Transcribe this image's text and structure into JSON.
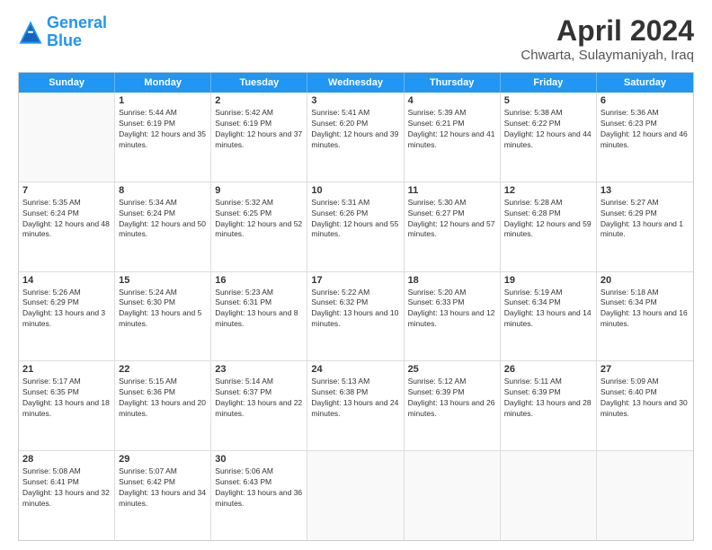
{
  "header": {
    "logo_line1": "General",
    "logo_line2": "Blue",
    "title": "April 2024",
    "subtitle": "Chwarta, Sulaymaniyah, Iraq"
  },
  "weekdays": [
    "Sunday",
    "Monday",
    "Tuesday",
    "Wednesday",
    "Thursday",
    "Friday",
    "Saturday"
  ],
  "weeks": [
    [
      {
        "day": "",
        "sunrise": "",
        "sunset": "",
        "daylight": ""
      },
      {
        "day": "1",
        "sunrise": "Sunrise: 5:44 AM",
        "sunset": "Sunset: 6:19 PM",
        "daylight": "Daylight: 12 hours and 35 minutes."
      },
      {
        "day": "2",
        "sunrise": "Sunrise: 5:42 AM",
        "sunset": "Sunset: 6:19 PM",
        "daylight": "Daylight: 12 hours and 37 minutes."
      },
      {
        "day": "3",
        "sunrise": "Sunrise: 5:41 AM",
        "sunset": "Sunset: 6:20 PM",
        "daylight": "Daylight: 12 hours and 39 minutes."
      },
      {
        "day": "4",
        "sunrise": "Sunrise: 5:39 AM",
        "sunset": "Sunset: 6:21 PM",
        "daylight": "Daylight: 12 hours and 41 minutes."
      },
      {
        "day": "5",
        "sunrise": "Sunrise: 5:38 AM",
        "sunset": "Sunset: 6:22 PM",
        "daylight": "Daylight: 12 hours and 44 minutes."
      },
      {
        "day": "6",
        "sunrise": "Sunrise: 5:36 AM",
        "sunset": "Sunset: 6:23 PM",
        "daylight": "Daylight: 12 hours and 46 minutes."
      }
    ],
    [
      {
        "day": "7",
        "sunrise": "Sunrise: 5:35 AM",
        "sunset": "Sunset: 6:24 PM",
        "daylight": "Daylight: 12 hours and 48 minutes."
      },
      {
        "day": "8",
        "sunrise": "Sunrise: 5:34 AM",
        "sunset": "Sunset: 6:24 PM",
        "daylight": "Daylight: 12 hours and 50 minutes."
      },
      {
        "day": "9",
        "sunrise": "Sunrise: 5:32 AM",
        "sunset": "Sunset: 6:25 PM",
        "daylight": "Daylight: 12 hours and 52 minutes."
      },
      {
        "day": "10",
        "sunrise": "Sunrise: 5:31 AM",
        "sunset": "Sunset: 6:26 PM",
        "daylight": "Daylight: 12 hours and 55 minutes."
      },
      {
        "day": "11",
        "sunrise": "Sunrise: 5:30 AM",
        "sunset": "Sunset: 6:27 PM",
        "daylight": "Daylight: 12 hours and 57 minutes."
      },
      {
        "day": "12",
        "sunrise": "Sunrise: 5:28 AM",
        "sunset": "Sunset: 6:28 PM",
        "daylight": "Daylight: 12 hours and 59 minutes."
      },
      {
        "day": "13",
        "sunrise": "Sunrise: 5:27 AM",
        "sunset": "Sunset: 6:29 PM",
        "daylight": "Daylight: 13 hours and 1 minute."
      }
    ],
    [
      {
        "day": "14",
        "sunrise": "Sunrise: 5:26 AM",
        "sunset": "Sunset: 6:29 PM",
        "daylight": "Daylight: 13 hours and 3 minutes."
      },
      {
        "day": "15",
        "sunrise": "Sunrise: 5:24 AM",
        "sunset": "Sunset: 6:30 PM",
        "daylight": "Daylight: 13 hours and 5 minutes."
      },
      {
        "day": "16",
        "sunrise": "Sunrise: 5:23 AM",
        "sunset": "Sunset: 6:31 PM",
        "daylight": "Daylight: 13 hours and 8 minutes."
      },
      {
        "day": "17",
        "sunrise": "Sunrise: 5:22 AM",
        "sunset": "Sunset: 6:32 PM",
        "daylight": "Daylight: 13 hours and 10 minutes."
      },
      {
        "day": "18",
        "sunrise": "Sunrise: 5:20 AM",
        "sunset": "Sunset: 6:33 PM",
        "daylight": "Daylight: 13 hours and 12 minutes."
      },
      {
        "day": "19",
        "sunrise": "Sunrise: 5:19 AM",
        "sunset": "Sunset: 6:34 PM",
        "daylight": "Daylight: 13 hours and 14 minutes."
      },
      {
        "day": "20",
        "sunrise": "Sunrise: 5:18 AM",
        "sunset": "Sunset: 6:34 PM",
        "daylight": "Daylight: 13 hours and 16 minutes."
      }
    ],
    [
      {
        "day": "21",
        "sunrise": "Sunrise: 5:17 AM",
        "sunset": "Sunset: 6:35 PM",
        "daylight": "Daylight: 13 hours and 18 minutes."
      },
      {
        "day": "22",
        "sunrise": "Sunrise: 5:15 AM",
        "sunset": "Sunset: 6:36 PM",
        "daylight": "Daylight: 13 hours and 20 minutes."
      },
      {
        "day": "23",
        "sunrise": "Sunrise: 5:14 AM",
        "sunset": "Sunset: 6:37 PM",
        "daylight": "Daylight: 13 hours and 22 minutes."
      },
      {
        "day": "24",
        "sunrise": "Sunrise: 5:13 AM",
        "sunset": "Sunset: 6:38 PM",
        "daylight": "Daylight: 13 hours and 24 minutes."
      },
      {
        "day": "25",
        "sunrise": "Sunrise: 5:12 AM",
        "sunset": "Sunset: 6:39 PM",
        "daylight": "Daylight: 13 hours and 26 minutes."
      },
      {
        "day": "26",
        "sunrise": "Sunrise: 5:11 AM",
        "sunset": "Sunset: 6:39 PM",
        "daylight": "Daylight: 13 hours and 28 minutes."
      },
      {
        "day": "27",
        "sunrise": "Sunrise: 5:09 AM",
        "sunset": "Sunset: 6:40 PM",
        "daylight": "Daylight: 13 hours and 30 minutes."
      }
    ],
    [
      {
        "day": "28",
        "sunrise": "Sunrise: 5:08 AM",
        "sunset": "Sunset: 6:41 PM",
        "daylight": "Daylight: 13 hours and 32 minutes."
      },
      {
        "day": "29",
        "sunrise": "Sunrise: 5:07 AM",
        "sunset": "Sunset: 6:42 PM",
        "daylight": "Daylight: 13 hours and 34 minutes."
      },
      {
        "day": "30",
        "sunrise": "Sunrise: 5:06 AM",
        "sunset": "Sunset: 6:43 PM",
        "daylight": "Daylight: 13 hours and 36 minutes."
      },
      {
        "day": "",
        "sunrise": "",
        "sunset": "",
        "daylight": ""
      },
      {
        "day": "",
        "sunrise": "",
        "sunset": "",
        "daylight": ""
      },
      {
        "day": "",
        "sunrise": "",
        "sunset": "",
        "daylight": ""
      },
      {
        "day": "",
        "sunrise": "",
        "sunset": "",
        "daylight": ""
      }
    ]
  ]
}
